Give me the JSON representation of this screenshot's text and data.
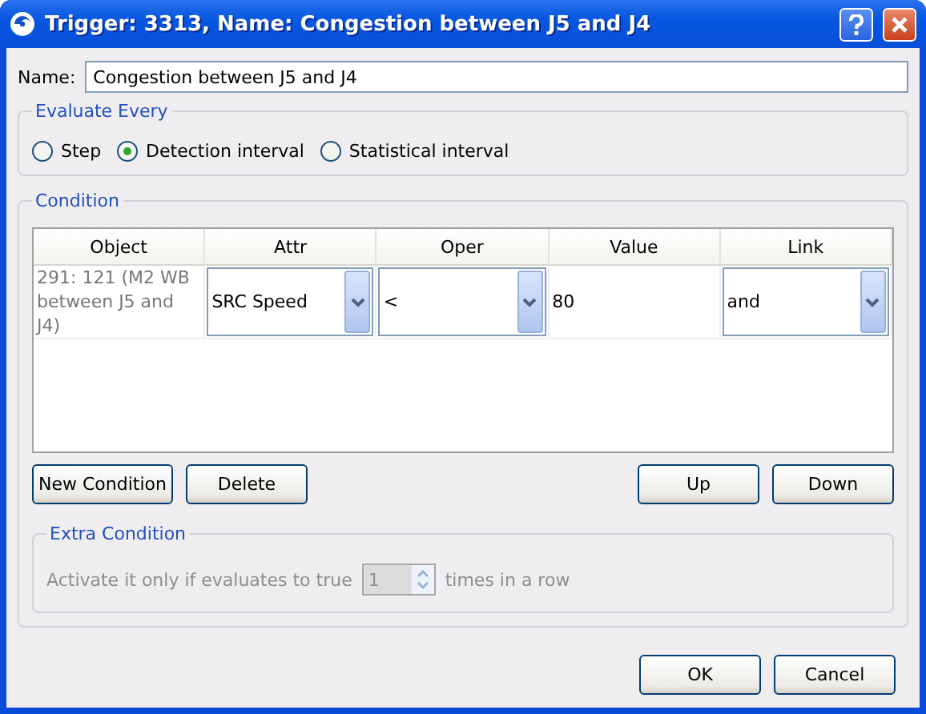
{
  "window": {
    "title": "Trigger: 3313, Name: Congestion between J5 and J4"
  },
  "name_field": {
    "label": "Name:",
    "value": "Congestion between J5 and J4"
  },
  "evaluate_every": {
    "title": "Evaluate Every",
    "options": [
      {
        "label": "Step",
        "selected": false
      },
      {
        "label": "Detection interval",
        "selected": true
      },
      {
        "label": "Statistical interval",
        "selected": false
      }
    ]
  },
  "condition": {
    "title": "Condition",
    "table": {
      "columns": [
        "Object",
        "Attr",
        "Oper",
        "Value",
        "Link"
      ],
      "rows": [
        {
          "cells": [
            {
              "kind": "text",
              "text": "291: 121 (M2 WB between J5 and J4)"
            },
            {
              "kind": "dropdown",
              "text": "SRC Speed"
            },
            {
              "kind": "dropdown",
              "text": "<"
            },
            {
              "kind": "plain",
              "text": "80"
            },
            {
              "kind": "dropdown",
              "text": "and"
            }
          ]
        }
      ]
    },
    "buttons_left": [
      "New Condition",
      "Delete"
    ],
    "buttons_right": [
      "Up",
      "Down"
    ],
    "extra_condition": {
      "title": "Extra Condition",
      "disabled": true,
      "label_before": "Activate it only if evaluates to true",
      "count": "1",
      "label_after": "times in a row"
    }
  },
  "footer_buttons": [
    "OK",
    "Cancel"
  ]
}
